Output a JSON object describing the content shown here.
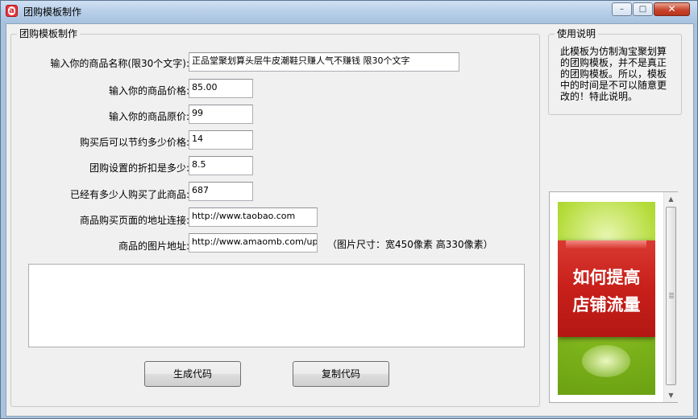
{
  "window": {
    "title": "团购模板制作",
    "controls": {
      "minimize": "–",
      "maximize": "□",
      "close": "✕"
    }
  },
  "form": {
    "group_title": "团购模板制作",
    "fields": [
      {
        "label": "输入你的商品名称(限30个文字):",
        "value": "正品堂聚划算头层牛皮潮鞋只赚人气不赚钱 限30个文字"
      },
      {
        "label": "输入你的商品价格:",
        "value": "85.00"
      },
      {
        "label": "输入你的商品原价:",
        "value": "99"
      },
      {
        "label": "购买后可以节约多少价格:",
        "value": "14"
      },
      {
        "label": "团购设置的折扣是多少:",
        "value": "8.5"
      },
      {
        "label": "已经有多少人购买了此商品:",
        "value": "687"
      },
      {
        "label": "商品购买页面的地址连接:",
        "value": "http://www.taobao.com"
      },
      {
        "label": "商品的图片地址:",
        "value": "http://www.amaomb.com/upload"
      }
    ],
    "image_size_note": "（图片尺寸：宽450像素 高330像素）",
    "output_code": ""
  },
  "buttons": {
    "generate": "生成代码",
    "copy": "复制代码"
  },
  "help": {
    "group_title": "使用说明",
    "text": "此模板为仿制淘宝聚划算的团购模板，并不是真正的团购模板。所以，模板中的时间是不可以随意更改的！特此说明。"
  },
  "preview": {
    "image_line1": "如何提高",
    "image_line2": "店铺流量",
    "scroll_up": "▲",
    "scroll_down": "▼"
  }
}
